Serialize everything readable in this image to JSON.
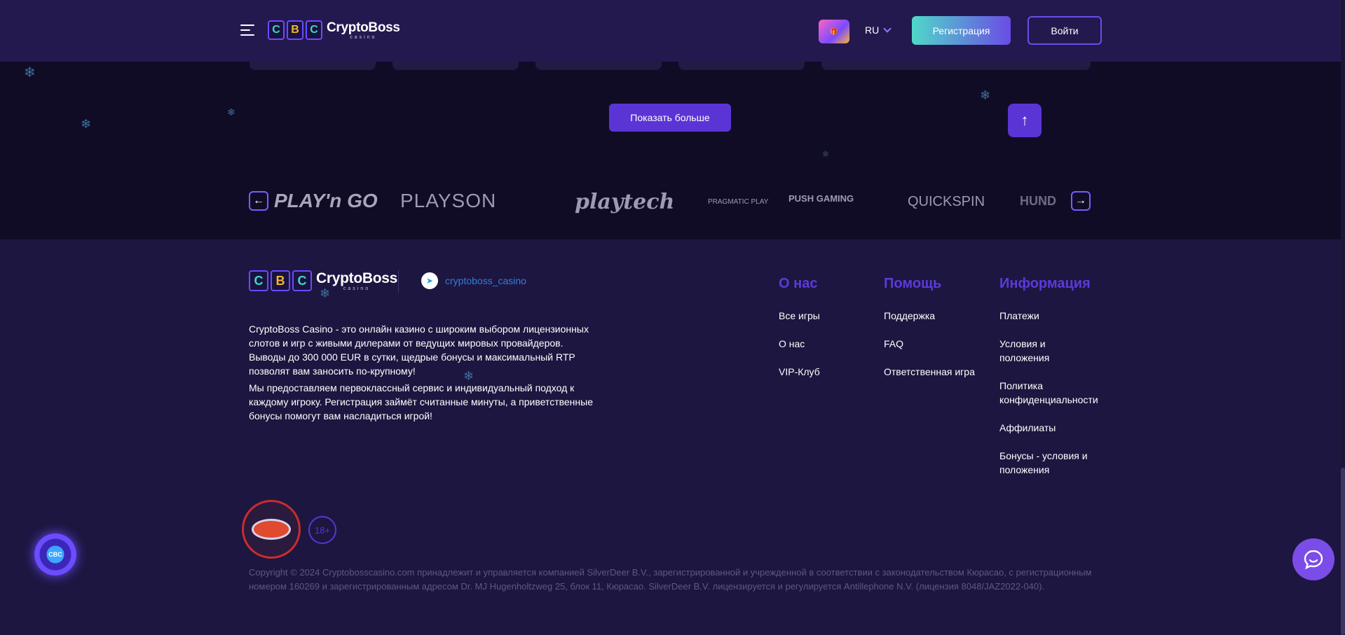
{
  "header": {
    "logo_name": "CryptoBoss",
    "logo_sub": "casino",
    "logo_letters": [
      "C",
      "B",
      "C"
    ],
    "promo_label": "🎁",
    "lang": "RU",
    "register_label": "Регистрация",
    "login_label": "Войти"
  },
  "main": {
    "show_more_label": "Показать больше",
    "scroll_top_icon": "↑"
  },
  "providers": {
    "prev_icon": "←",
    "next_icon": "→",
    "items": [
      "PLAY'n GO",
      "PLAYSON",
      "playtech",
      "PRAGMATIC PLAY",
      "PUSH GAMING",
      "QUICKSPIN",
      "HUND"
    ]
  },
  "footer": {
    "logo_name": "CryptoBoss",
    "logo_sub": "casino",
    "telegram_handle": "cryptoboss_casino",
    "about_p1": "CryptoBoss Casino - это онлайн казино с широким выбором лицензионных слотов и игр с живыми дилерами от ведущих мировых провайдеров. Выводы до 300 000 EUR в сутки, щедрые бонусы и максимальный RTP позволят вам заносить по-крупному!",
    "about_p2": "Мы предоставляем первоклассный сервис и индивидуальный подход к каждому игроку. Регистрация займёт считанные минуты, а приветственные бонусы помогут вам насладиться игрой!",
    "columns": [
      {
        "title": "О нас",
        "links": [
          "Все игры",
          "О нас",
          "VIP-Клуб"
        ]
      },
      {
        "title": "Помощь",
        "links": [
          "Поддержка",
          "FAQ",
          "Ответственная игра"
        ]
      },
      {
        "title": "Информация",
        "links": [
          "Платежи",
          "Условия и положения",
          "Политика конфиденциальности",
          "Аффилиаты",
          "Бонусы - условия и положения"
        ]
      }
    ],
    "age_badge": "18+",
    "copyright": "Copyright © 2024 Cryptobosscasino.com принадлежит и управляется компанией SilverDeer B.V., зарегистрированной и учрежденной в соответствии с законодательством Кюрасао, с регистрационным номером 160269 и зарегистрированным адресом Dr. MJ Hugenholtzweg 25, блок 11, Кюрасао. SilverDeer B.V. лицензируется и регулируется Antillephone N.V. (лицензия 8048/JAZ2022-040)."
  },
  "widgets": {
    "chip_label": "CBC"
  },
  "colors": {
    "background": "#110c26",
    "header": "#24194f",
    "footer": "#1d1640",
    "accent": "#5b34d6",
    "teal": "#4fd8c8"
  }
}
